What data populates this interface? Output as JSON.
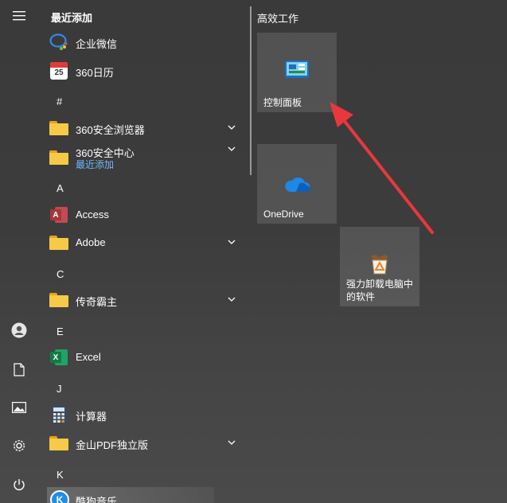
{
  "rail": {
    "icons": [
      "menu-icon",
      "user-icon",
      "document-icon",
      "pictures-icon",
      "settings-icon",
      "power-icon"
    ]
  },
  "apps": {
    "recent_header": "最近添加",
    "recent": [
      {
        "label": "企业微信",
        "icon": "wecom-icon"
      },
      {
        "label": "360日历",
        "icon": "calendar-360-icon",
        "calendar_day": "25"
      }
    ],
    "letters": [
      "#",
      "A",
      "C",
      "E",
      "J",
      "K"
    ],
    "items": {
      "browser360": {
        "label": "360安全浏览器"
      },
      "security360": {
        "label": "360安全中心",
        "sub": "最近添加"
      },
      "access": {
        "label": "Access",
        "icon_letter": "A"
      },
      "adobe": {
        "label": "Adobe"
      },
      "chuanqi": {
        "label": "传奇霸主"
      },
      "excel": {
        "label": "Excel",
        "icon_letter": "X"
      },
      "calc": {
        "label": "计算器"
      },
      "wps_pdf": {
        "label": "金山PDF独立版"
      },
      "kugou": {
        "label": "酷狗音乐",
        "icon_letter": "K"
      }
    }
  },
  "tiles": {
    "group_title": "高效工作",
    "control_panel": "控制面板",
    "onedrive": "OneDrive",
    "uninstall_line1": "强力卸载电脑中",
    "uninstall_line2": "的软件"
  },
  "colors": {
    "annotation_arrow": "#e8383d",
    "recent_sub": "#6fb8ff",
    "folder": "#f7c948"
  }
}
